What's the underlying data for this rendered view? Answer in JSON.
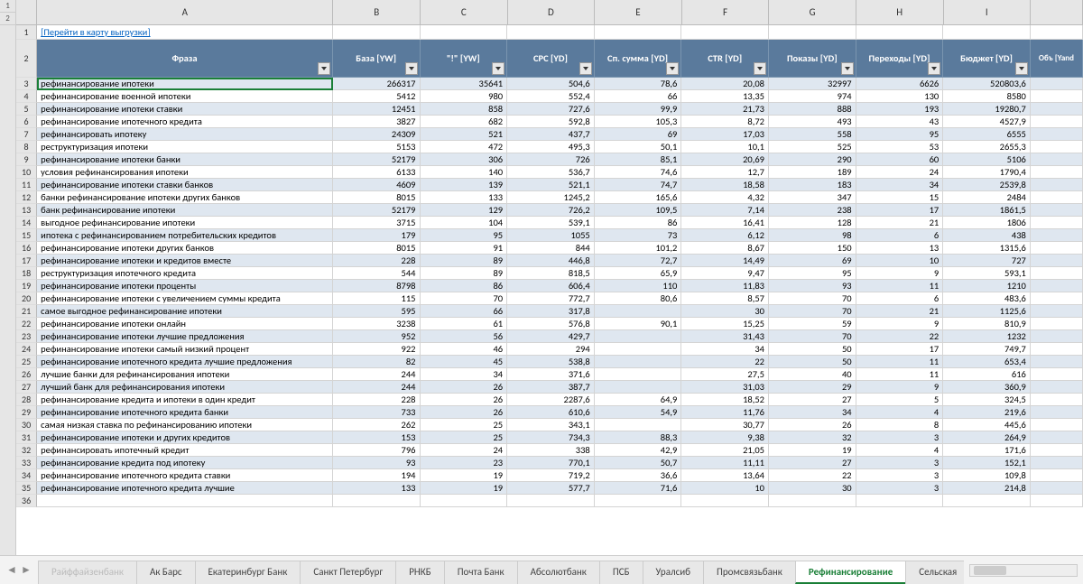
{
  "outline": [
    "1",
    "2"
  ],
  "columns": [
    "A",
    "B",
    "C",
    "D",
    "E",
    "F",
    "G",
    "H",
    "I"
  ],
  "link_text": "[Перейти в карту выгрузки]",
  "headers": [
    "Фраза",
    "База [YW]",
    "\"!\" [YW]",
    "CPC [YD]",
    "Сп. сумма [YD]",
    "CTR [YD]",
    "Показы [YD]",
    "Переходы [YD]",
    "Бюджет [YD]",
    "Объ [Yand"
  ],
  "rows": [
    {
      "n": 3,
      "a": "рефинансирование ипотеки",
      "b": "266317",
      "c": "35641",
      "d": "504,6",
      "e": "78,6",
      "f": "20,08",
      "g": "32997",
      "h": "6626",
      "i": "520803,6"
    },
    {
      "n": 4,
      "a": "рефинансирование военной ипотеки",
      "b": "5412",
      "c": "980",
      "d": "552,4",
      "e": "66",
      "f": "13,35",
      "g": "974",
      "h": "130",
      "i": "8580"
    },
    {
      "n": 5,
      "a": "рефинансирование ипотеки ставки",
      "b": "12451",
      "c": "858",
      "d": "727,6",
      "e": "99,9",
      "f": "21,73",
      "g": "888",
      "h": "193",
      "i": "19280,7"
    },
    {
      "n": 6,
      "a": "рефинансирование ипотечного кредита",
      "b": "3827",
      "c": "682",
      "d": "592,8",
      "e": "105,3",
      "f": "8,72",
      "g": "493",
      "h": "43",
      "i": "4527,9"
    },
    {
      "n": 7,
      "a": "рефинансировать ипотеку",
      "b": "24309",
      "c": "521",
      "d": "437,7",
      "e": "69",
      "f": "17,03",
      "g": "558",
      "h": "95",
      "i": "6555"
    },
    {
      "n": 8,
      "a": "реструктуризация ипотеки",
      "b": "5153",
      "c": "472",
      "d": "495,3",
      "e": "50,1",
      "f": "10,1",
      "g": "525",
      "h": "53",
      "i": "2655,3"
    },
    {
      "n": 9,
      "a": "рефинансирование ипотеки банки",
      "b": "52179",
      "c": "306",
      "d": "726",
      "e": "85,1",
      "f": "20,69",
      "g": "290",
      "h": "60",
      "i": "5106"
    },
    {
      "n": 10,
      "a": "условия рефинансирования ипотеки",
      "b": "6133",
      "c": "140",
      "d": "536,7",
      "e": "74,6",
      "f": "12,7",
      "g": "189",
      "h": "24",
      "i": "1790,4"
    },
    {
      "n": 11,
      "a": "рефинансирование ипотеки ставки банков",
      "b": "4609",
      "c": "139",
      "d": "521,1",
      "e": "74,7",
      "f": "18,58",
      "g": "183",
      "h": "34",
      "i": "2539,8"
    },
    {
      "n": 12,
      "a": "банки рефинансирование ипотеки других банков",
      "b": "8015",
      "c": "133",
      "d": "1245,2",
      "e": "165,6",
      "f": "4,32",
      "g": "347",
      "h": "15",
      "i": "2484"
    },
    {
      "n": 13,
      "a": "банк рефинансирование ипотеки",
      "b": "52179",
      "c": "129",
      "d": "726,2",
      "e": "109,5",
      "f": "7,14",
      "g": "238",
      "h": "17",
      "i": "1861,5"
    },
    {
      "n": 14,
      "a": "выгодное рефинансирование ипотеки",
      "b": "3715",
      "c": "104",
      "d": "539,1",
      "e": "86",
      "f": "16,41",
      "g": "128",
      "h": "21",
      "i": "1806"
    },
    {
      "n": 15,
      "a": "ипотека с рефинансированием потребительских кредитов",
      "b": "179",
      "c": "95",
      "d": "1055",
      "e": "73",
      "f": "6,12",
      "g": "98",
      "h": "6",
      "i": "438"
    },
    {
      "n": 16,
      "a": "рефинансирование ипотеки других банков",
      "b": "8015",
      "c": "91",
      "d": "844",
      "e": "101,2",
      "f": "8,67",
      "g": "150",
      "h": "13",
      "i": "1315,6"
    },
    {
      "n": 17,
      "a": "рефинансирование ипотеки и кредитов вместе",
      "b": "228",
      "c": "89",
      "d": "446,8",
      "e": "72,7",
      "f": "14,49",
      "g": "69",
      "h": "10",
      "i": "727"
    },
    {
      "n": 18,
      "a": "реструктуризация ипотечного кредита",
      "b": "544",
      "c": "89",
      "d": "818,5",
      "e": "65,9",
      "f": "9,47",
      "g": "95",
      "h": "9",
      "i": "593,1"
    },
    {
      "n": 19,
      "a": "рефинансирование ипотеки проценты",
      "b": "8798",
      "c": "86",
      "d": "606,4",
      "e": "110",
      "f": "11,83",
      "g": "93",
      "h": "11",
      "i": "1210"
    },
    {
      "n": 20,
      "a": "рефинансирование ипотеки с увеличением суммы кредита",
      "b": "115",
      "c": "70",
      "d": "772,7",
      "e": "80,6",
      "f": "8,57",
      "g": "70",
      "h": "6",
      "i": "483,6"
    },
    {
      "n": 21,
      "a": "самое выгодное рефинансирование ипотеки",
      "b": "595",
      "c": "66",
      "d": "317,8",
      "e": "",
      "f": "30",
      "g": "70",
      "h": "21",
      "i": "1125,6"
    },
    {
      "n": 22,
      "a": "рефинансирование ипотеки онлайн",
      "b": "3238",
      "c": "61",
      "d": "576,8",
      "e": "90,1",
      "f": "15,25",
      "g": "59",
      "h": "9",
      "i": "810,9"
    },
    {
      "n": 23,
      "a": "рефинансирование ипотеки лучшие предложения",
      "b": "952",
      "c": "56",
      "d": "429,7",
      "e": "",
      "f": "31,43",
      "g": "70",
      "h": "22",
      "i": "1232"
    },
    {
      "n": 24,
      "a": "рефинансирование ипотеки самый низкий процент",
      "b": "922",
      "c": "46",
      "d": "294",
      "e": "",
      "f": "34",
      "g": "50",
      "h": "17",
      "i": "749,7"
    },
    {
      "n": 25,
      "a": "рефинансирование ипотечного кредита лучшие предложения",
      "b": "82",
      "c": "45",
      "d": "538,8",
      "e": "",
      "f": "22",
      "g": "50",
      "h": "11",
      "i": "653,4"
    },
    {
      "n": 26,
      "a": "лучшие банки для рефинансирования ипотеки",
      "b": "244",
      "c": "34",
      "d": "371,6",
      "e": "",
      "f": "27,5",
      "g": "40",
      "h": "11",
      "i": "616"
    },
    {
      "n": 27,
      "a": "лучший банк для рефинансирования ипотеки",
      "b": "244",
      "c": "26",
      "d": "387,7",
      "e": "",
      "f": "31,03",
      "g": "29",
      "h": "9",
      "i": "360,9"
    },
    {
      "n": 28,
      "a": "рефинансирование кредита и ипотеки в один кредит",
      "b": "228",
      "c": "26",
      "d": "2287,6",
      "e": "64,9",
      "f": "18,52",
      "g": "27",
      "h": "5",
      "i": "324,5"
    },
    {
      "n": 29,
      "a": "рефинансирование ипотечного кредита банки",
      "b": "733",
      "c": "26",
      "d": "610,6",
      "e": "54,9",
      "f": "11,76",
      "g": "34",
      "h": "4",
      "i": "219,6"
    },
    {
      "n": 30,
      "a": "самая низкая ставка по рефинансированию ипотеки",
      "b": "262",
      "c": "25",
      "d": "343,1",
      "e": "",
      "f": "30,77",
      "g": "26",
      "h": "8",
      "i": "445,6"
    },
    {
      "n": 31,
      "a": "рефинансирование ипотеки и других кредитов",
      "b": "153",
      "c": "25",
      "d": "734,3",
      "e": "88,3",
      "f": "9,38",
      "g": "32",
      "h": "3",
      "i": "264,9"
    },
    {
      "n": 32,
      "a": "рефинансировать ипотечный кредит",
      "b": "796",
      "c": "24",
      "d": "338",
      "e": "42,9",
      "f": "21,05",
      "g": "19",
      "h": "4",
      "i": "171,6"
    },
    {
      "n": 33,
      "a": "рефинансирование кредита под ипотеку",
      "b": "93",
      "c": "23",
      "d": "770,1",
      "e": "50,7",
      "f": "11,11",
      "g": "27",
      "h": "3",
      "i": "152,1"
    },
    {
      "n": 34,
      "a": "рефинансирование ипотечного кредита ставки",
      "b": "194",
      "c": "19",
      "d": "719,2",
      "e": "36,6",
      "f": "13,64",
      "g": "22",
      "h": "3",
      "i": "109,8"
    },
    {
      "n": 35,
      "a": "рефинансирование ипотечного кредита лучшие",
      "b": "133",
      "c": "19",
      "d": "577,7",
      "e": "71,6",
      "f": "10",
      "g": "30",
      "h": "3",
      "i": "214,8"
    },
    {
      "n": 36,
      "a": "",
      "b": "",
      "c": "",
      "d": "",
      "e": "",
      "f": "",
      "g": "",
      "h": "",
      "i": ""
    }
  ],
  "tabs": [
    "Райффайзенбанк",
    "Ак Барс",
    "Екатеринбург Банк",
    "Санкт Петербург",
    "РНКБ",
    "Почта Банк",
    "Абсолютбанк",
    "ПСБ",
    "Уралсиб",
    "Промсвязьбанк",
    "Рефинансирование",
    "Сельская"
  ],
  "active_tab": 10
}
